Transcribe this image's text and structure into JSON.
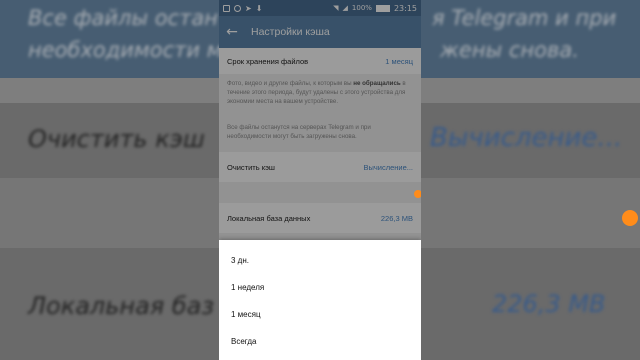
{
  "status_bar": {
    "battery_percent": "100%",
    "time": "23:15",
    "icons": [
      "mail-icon",
      "viber-icon",
      "telegram-icon",
      "download-icon",
      "wifi-icon",
      "signal-icon",
      "battery-icon"
    ]
  },
  "app_bar": {
    "title": "Настройки кэша"
  },
  "cache_period": {
    "label": "Срок хранения файлов",
    "value": "1 месяц"
  },
  "info_text": {
    "line1_pre": "Фото, видео и другие файлы, к которым вы ",
    "line1_bold": "не обращались",
    "line1_post": " в течение этого периода, будут удалены с этого устройства для экономии места на вашем устройстве."
  },
  "info_text2": "Все файлы останутся на серверах Telegram и при необходимости могут быть загружены снова.",
  "clear_cache": {
    "label": "Очистить кэш",
    "value": "Вычисление..."
  },
  "local_db": {
    "label": "Локальная база данных",
    "value": "226,3 МВ"
  },
  "period_menu": {
    "options": [
      "3 дн.",
      "1 неделя",
      "1 месяц",
      "Всегда"
    ]
  },
  "background": {
    "top_line1": "Все файлы остан",
    "top_line1b": "я Telegram и при",
    "top_line2": "необходимости м",
    "top_line2b": "жены снова.",
    "clear_label": "Очистить кэш",
    "clear_value": "Вычисление...",
    "db_label": "Локальная баз",
    "db_value": "226,3 МВ"
  },
  "colors": {
    "accent_blue": "#5b84aa",
    "link_blue": "#4a86c5",
    "status_bar": "#4a6f94",
    "orange": "#ff8c1a"
  }
}
